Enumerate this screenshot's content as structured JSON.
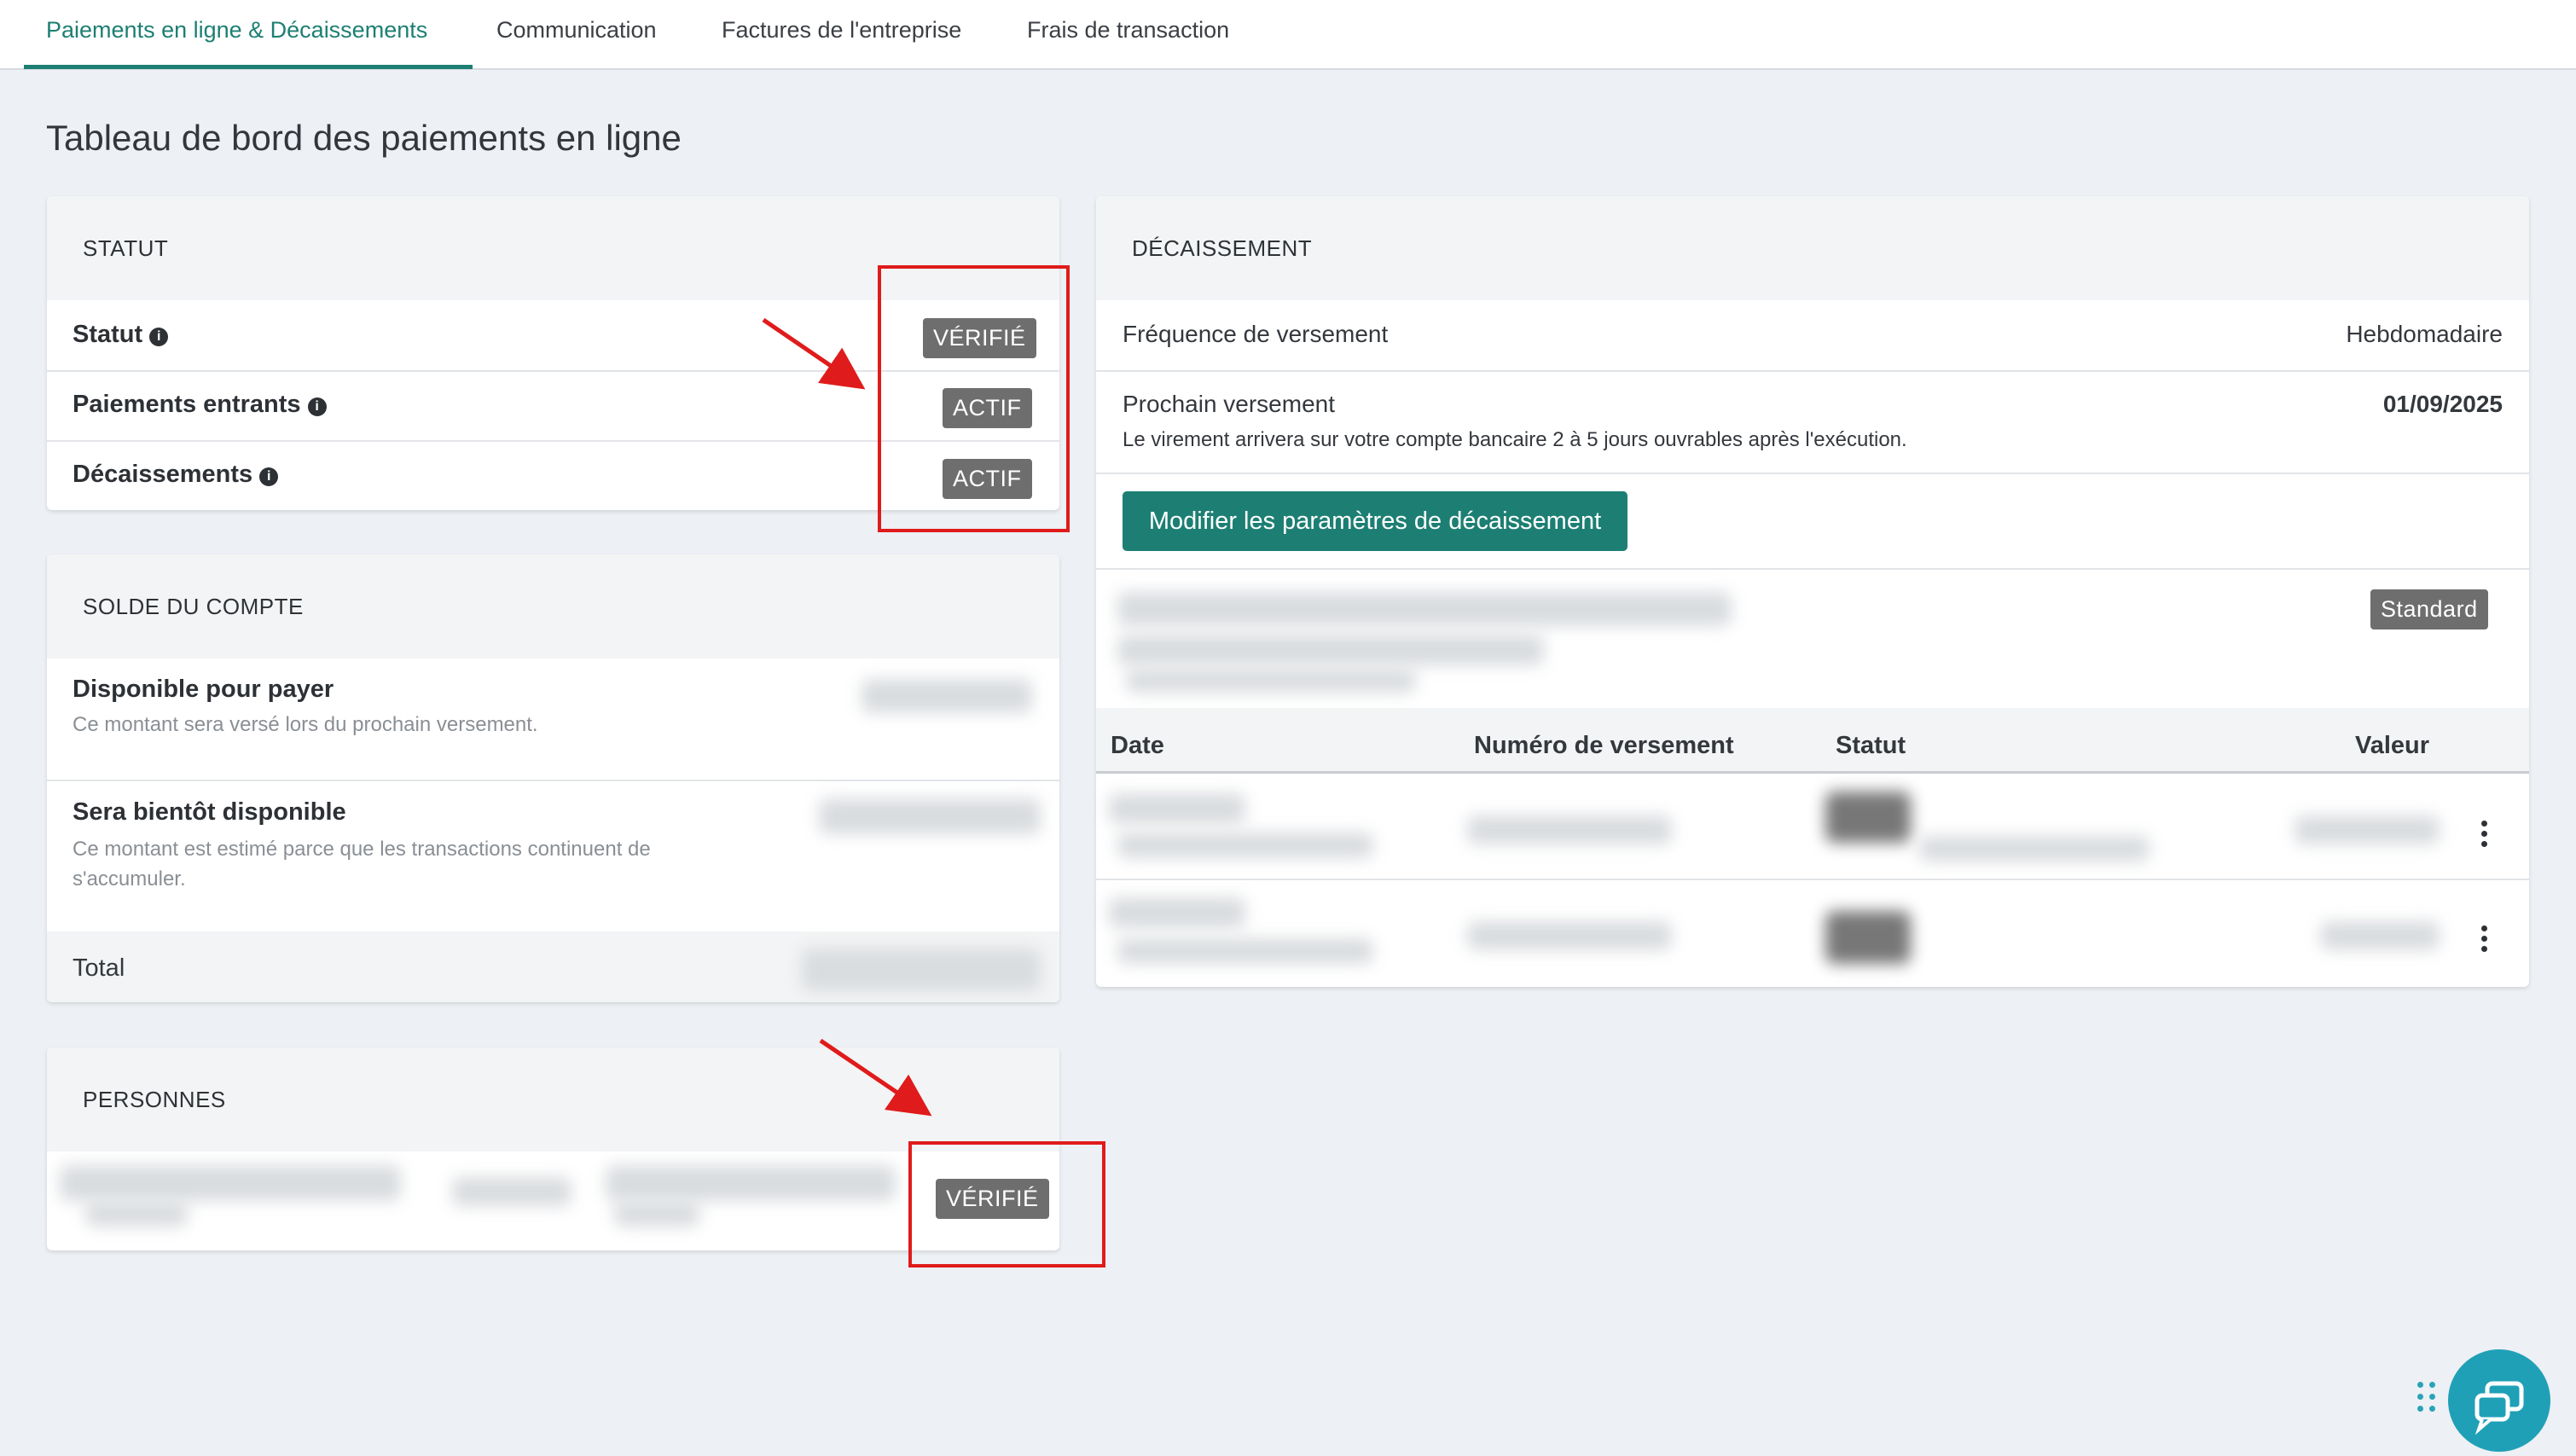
{
  "tabs": [
    {
      "label": "Paiements en ligne & Décaissements",
      "active": true
    },
    {
      "label": "Communication",
      "active": false
    },
    {
      "label": "Factures de l'entreprise",
      "active": false
    },
    {
      "label": "Frais de transaction",
      "active": false
    }
  ],
  "page_title": "Tableau de bord des paiements en ligne",
  "status_card": {
    "title": "STATUT",
    "rows": [
      {
        "label": "Statut",
        "badge": "VÉRIFIÉ"
      },
      {
        "label": "Paiements entrants",
        "badge": "ACTIF"
      },
      {
        "label": "Décaissements",
        "badge": "ACTIF"
      }
    ]
  },
  "balance_card": {
    "title": "SOLDE DU COMPTE",
    "available": {
      "label": "Disponible pour payer",
      "note": "Ce montant sera versé lors du prochain versement."
    },
    "pending": {
      "label": "Sera bientôt disponible",
      "note": "Ce montant est estimé parce que les transactions continuent de s'accumuler."
    },
    "total_label": "Total"
  },
  "persons_card": {
    "title": "PERSONNES",
    "badge": "VÉRIFIÉ"
  },
  "payout_card": {
    "title": "DÉCAISSEMENT",
    "frequency_label": "Fréquence de versement",
    "frequency_value": "Hebdomadaire",
    "next_label": "Prochain versement",
    "next_value": "01/09/2025",
    "next_note": "Le virement arrivera sur votre compte bancaire 2 à 5 jours ouvrables après l'exécution.",
    "modify_button": "Modifier les paramètres de décaissement",
    "account_badge": "Standard",
    "table_headers": [
      "Date",
      "Numéro de versement",
      "Statut",
      "Valeur"
    ]
  },
  "colors": {
    "accent": "#1d7f73",
    "badge_bg": "#6e6e6e",
    "annotation_red": "#e01b1b",
    "chat_bubble": "#1fa0b7"
  }
}
